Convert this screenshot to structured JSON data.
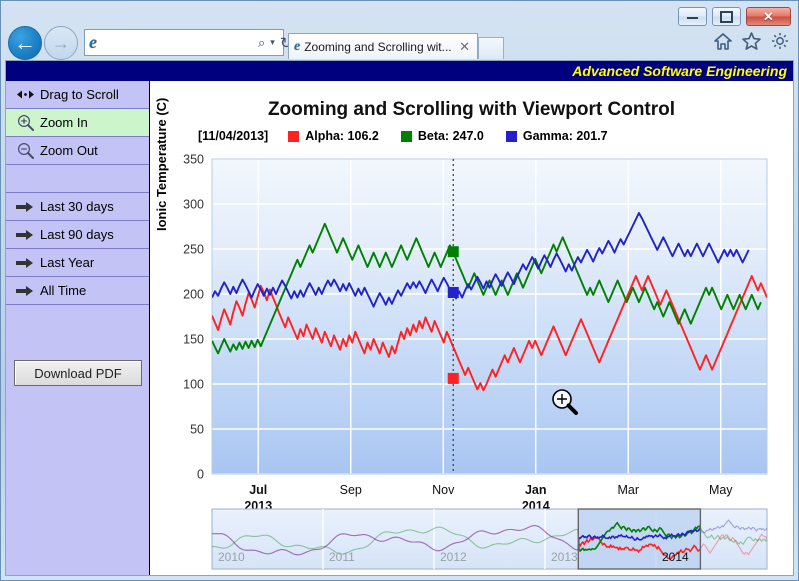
{
  "window": {
    "minimize_label": "Minimize",
    "maximize_label": "Maximize",
    "close_label": "✕"
  },
  "browser": {
    "back_label": "←",
    "forward_label": "→",
    "address_value": "",
    "address_placeholder": "",
    "search_icon": "⌕",
    "dropdown_icon": "▾",
    "refresh_icon": "↻",
    "logo_letter": "e",
    "tab_title": "Zooming and Scrolling wit...",
    "tab_close": "✕",
    "home_icon": "home-icon",
    "favorites_icon": "star-icon",
    "settings_icon": "gear-icon"
  },
  "page": {
    "banner_text": "Advanced Software Engineering"
  },
  "sidebar": {
    "items": [
      {
        "label": "Drag to Scroll",
        "icon": "drag-horizontal-icon",
        "active": false
      },
      {
        "label": "Zoom In",
        "icon": "zoom-in-icon",
        "active": true
      },
      {
        "label": "Zoom Out",
        "icon": "zoom-out-icon",
        "active": false
      },
      {
        "label": "Last 30 days",
        "icon": "arrow-right-icon",
        "active": false
      },
      {
        "label": "Last 90 days",
        "icon": "arrow-right-icon",
        "active": false
      },
      {
        "label": "Last Year",
        "icon": "arrow-right-icon",
        "active": false
      },
      {
        "label": "All Time",
        "icon": "arrow-right-icon",
        "active": false
      }
    ],
    "download_button": "Download PDF"
  },
  "chart_data": {
    "type": "line",
    "title": "Zooming and Scrolling with Viewport Control",
    "xlabel": "",
    "ylabel": "Ionic Temperature (C)",
    "ylim": [
      0,
      350
    ],
    "yticks": [
      0,
      50,
      100,
      150,
      200,
      250,
      300,
      350
    ],
    "grid": true,
    "legend_position": "top-left",
    "cursor_date": "[11/04/2013]",
    "xticks": [
      {
        "label": "Jul",
        "sublabel": "2013",
        "bold": true
      },
      {
        "label": "Sep",
        "sublabel": "",
        "bold": false
      },
      {
        "label": "Nov",
        "sublabel": "",
        "bold": false
      },
      {
        "label": "Jan",
        "sublabel": "2014",
        "bold": true
      },
      {
        "label": "Mar",
        "sublabel": "",
        "bold": false
      },
      {
        "label": "May",
        "sublabel": "",
        "bold": false
      }
    ],
    "series": [
      {
        "name": "Alpha",
        "color": "#ff2222",
        "cursor_value": 106.2,
        "legend": "Alpha: 106.2",
        "values": [
          176,
          168,
          160,
          172,
          183,
          175,
          166,
          180,
          192,
          185,
          176,
          189,
          201,
          194,
          185,
          197,
          209,
          202,
          193,
          205,
          196,
          188,
          179,
          171,
          163,
          174,
          166,
          158,
          150,
          161,
          153,
          166,
          158,
          150,
          162,
          154,
          146,
          158,
          150,
          142,
          154,
          146,
          138,
          150,
          142,
          154,
          146,
          158,
          150,
          142,
          134,
          146,
          138,
          150,
          142,
          134,
          146,
          138,
          130,
          142,
          134,
          146,
          158,
          150,
          162,
          154,
          166,
          158,
          170,
          162,
          174,
          166,
          158,
          170,
          162,
          154,
          146,
          158,
          150,
          142,
          134,
          126,
          118,
          110,
          118,
          110,
          102,
          94,
          101,
          93,
          100,
          108,
          116,
          108,
          116,
          124,
          132,
          124,
          132,
          140,
          132,
          124,
          132,
          140,
          148,
          140,
          148,
          140,
          132,
          140,
          148,
          156,
          164,
          156,
          148,
          140,
          132,
          140,
          148,
          156,
          164,
          172,
          164,
          156,
          148,
          140,
          132,
          124,
          132,
          140,
          148,
          156,
          164,
          172,
          180,
          188,
          196,
          204,
          212,
          220,
          212,
          204,
          212,
          220,
          212,
          204,
          196,
          188,
          196,
          204,
          196,
          188,
          180,
          172,
          164,
          156,
          148,
          140,
          132,
          124,
          116,
          124,
          132,
          124,
          116,
          124,
          132,
          140,
          148,
          156,
          164,
          172,
          180,
          188,
          196,
          204,
          212,
          220,
          212,
          204,
          212,
          204,
          196
        ]
      },
      {
        "name": "Beta",
        "color": "#008000",
        "cursor_value": 247.0,
        "legend": "Beta: 247.0",
        "values": [
          148,
          141,
          134,
          142,
          150,
          143,
          136,
          144,
          138,
          146,
          139,
          147,
          140,
          148,
          141,
          149,
          142,
          150,
          158,
          166,
          174,
          182,
          190,
          198,
          206,
          214,
          222,
          230,
          238,
          230,
          238,
          246,
          254,
          246,
          254,
          262,
          270,
          278,
          270,
          262,
          254,
          246,
          254,
          262,
          254,
          246,
          238,
          246,
          254,
          246,
          238,
          230,
          238,
          246,
          238,
          230,
          238,
          246,
          238,
          230,
          238,
          246,
          254,
          246,
          238,
          246,
          254,
          262,
          254,
          246,
          238,
          230,
          238,
          246,
          238,
          230,
          238,
          246,
          254,
          247,
          239,
          231,
          223,
          215,
          207,
          215,
          223,
          215,
          207,
          199,
          207,
          215,
          207,
          199,
          207,
          215,
          207,
          199,
          207,
          215,
          223,
          215,
          207,
          215,
          223,
          231,
          239,
          231,
          223,
          231,
          239,
          247,
          255,
          247,
          255,
          263,
          255,
          247,
          239,
          231,
          223,
          215,
          207,
          199,
          207,
          199,
          207,
          215,
          207,
          199,
          191,
          199,
          207,
          215,
          207,
          199,
          191,
          199,
          207,
          199,
          191,
          199,
          207,
          199,
          191,
          183,
          191,
          183,
          175,
          183,
          191,
          183,
          175,
          167,
          175,
          183,
          175,
          167,
          175,
          183,
          191,
          199,
          207,
          199,
          207,
          199,
          191,
          183,
          191,
          199,
          191,
          183,
          191,
          199,
          191,
          183,
          191,
          199,
          191,
          183,
          191
        ]
      },
      {
        "name": "Gamma",
        "color": "#2222cc",
        "cursor_value": 201.7,
        "legend": "Gamma: 201.7",
        "values": [
          196,
          203,
          198,
          206,
          213,
          207,
          200,
          208,
          201,
          209,
          216,
          210,
          203,
          196,
          204,
          211,
          205,
          198,
          206,
          199,
          207,
          200,
          208,
          215,
          209,
          202,
          195,
          203,
          196,
          204,
          197,
          205,
          212,
          206,
          199,
          207,
          200,
          208,
          215,
          209,
          216,
          210,
          203,
          211,
          204,
          212,
          205,
          198,
          206,
          199,
          207,
          200,
          193,
          186,
          194,
          201,
          195,
          188,
          196,
          189,
          197,
          204,
          198,
          205,
          212,
          206,
          213,
          207,
          214,
          208,
          201,
          209,
          216,
          210,
          203,
          211,
          218,
          212,
          205,
          202,
          195,
          203,
          196,
          204,
          211,
          205,
          212,
          219,
          213,
          206,
          214,
          207,
          215,
          222,
          216,
          209,
          217,
          224,
          218,
          211,
          219,
          226,
          233,
          227,
          234,
          241,
          235,
          228,
          236,
          243,
          237,
          230,
          238,
          245,
          239,
          232,
          225,
          233,
          226,
          234,
          241,
          235,
          242,
          249,
          243,
          236,
          244,
          251,
          245,
          252,
          259,
          253,
          246,
          254,
          261,
          255,
          262,
          269,
          276,
          283,
          290,
          284,
          277,
          270,
          263,
          256,
          249,
          256,
          263,
          256,
          249,
          242,
          249,
          256,
          249,
          242,
          249,
          242,
          249,
          256,
          249,
          242,
          249,
          256,
          249,
          242,
          235,
          242,
          249,
          242,
          249,
          242,
          249,
          242,
          235,
          242,
          249
        ]
      }
    ],
    "navigator": {
      "years": [
        "2010",
        "2011",
        "2012",
        "2013",
        "2014"
      ],
      "selected_year": "2014",
      "selection_start_pct": 66,
      "selection_end_pct": 88
    }
  }
}
